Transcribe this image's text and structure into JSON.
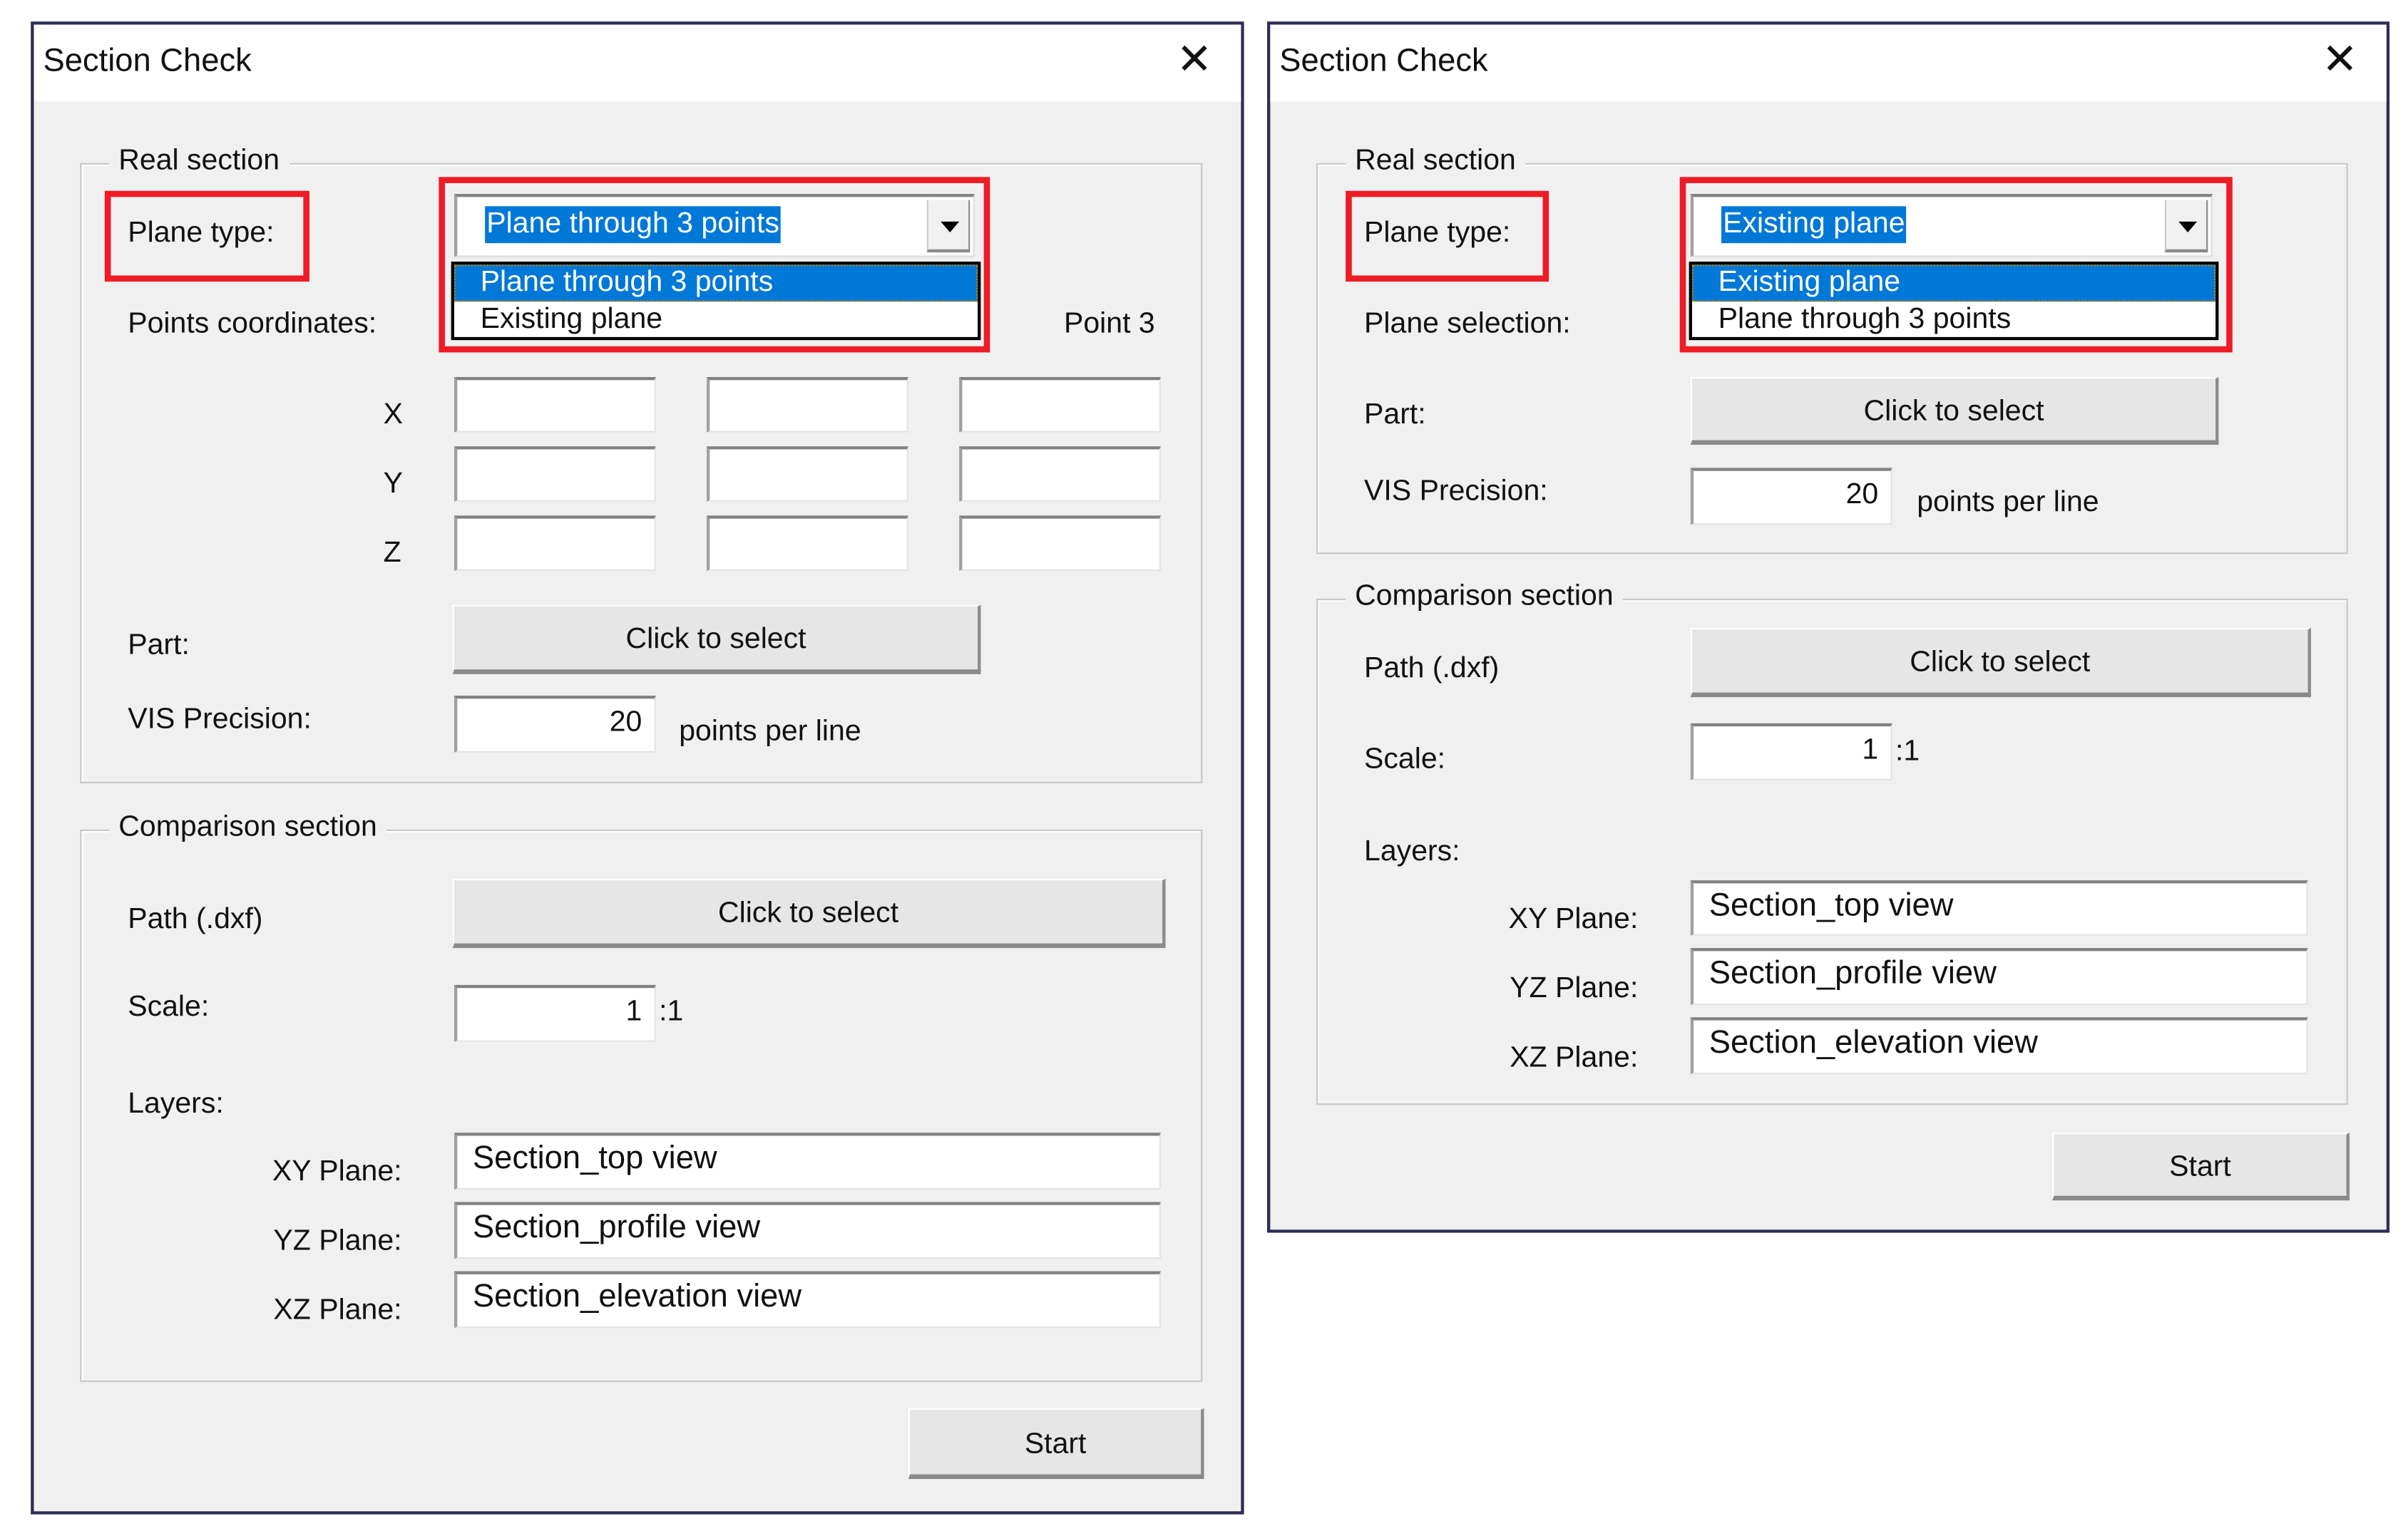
{
  "left": {
    "title": "Section Check",
    "close": "✕",
    "real_section": {
      "legend": "Real section",
      "plane_type_label": "Plane type:",
      "plane_type_value": "Plane through  3 points",
      "options": [
        "Plane through  3 points",
        "Existing plane"
      ],
      "points_label": "Points coordinates:",
      "point3_label": "Point 3",
      "axes": [
        "X",
        "Y",
        "Z"
      ],
      "part_label": "Part:",
      "part_button": "Click to select",
      "vis_label": "VIS Precision:",
      "vis_value": "20",
      "vis_unit": "points per line"
    },
    "comparison": {
      "legend": "Comparison section",
      "path_label": "Path (.dxf)",
      "path_button": "Click to select",
      "scale_label": "Scale:",
      "scale_value": "1",
      "scale_suffix": ":1",
      "layers_label": "Layers:",
      "xy_label": "XY Plane:",
      "xy_value": "Section_top view",
      "yz_label": "YZ Plane:",
      "yz_value": "Section_profile view",
      "xz_label": "XZ Plane:",
      "xz_value": "Section_elevation view"
    },
    "start": "Start"
  },
  "right": {
    "title": "Section Check",
    "close": "✕",
    "real_section": {
      "legend": "Real section",
      "plane_type_label": "Plane type:",
      "plane_type_value": "Existing plane",
      "options": [
        "Existing plane",
        "Plane through  3 points"
      ],
      "plane_selection_label": "Plane selection:",
      "part_label": "Part:",
      "part_button": "Click to select",
      "vis_label": "VIS Precision:",
      "vis_value": "20",
      "vis_unit": "points per line"
    },
    "comparison": {
      "legend": "Comparison section",
      "path_label": "Path (.dxf)",
      "path_button": "Click to select",
      "scale_label": "Scale:",
      "scale_value": "1",
      "scale_suffix": ":1",
      "layers_label": "Layers:",
      "xy_label": "XY Plane:",
      "xy_value": "Section_top view",
      "yz_label": "YZ Plane:",
      "yz_value": "Section_profile view",
      "xz_label": "XZ Plane:",
      "xz_value": "Section_elevation view"
    },
    "start": "Start"
  },
  "colors": {
    "highlight": "#0078d7",
    "annotation": "#ee1c24",
    "window_border": "#2d2d55"
  }
}
